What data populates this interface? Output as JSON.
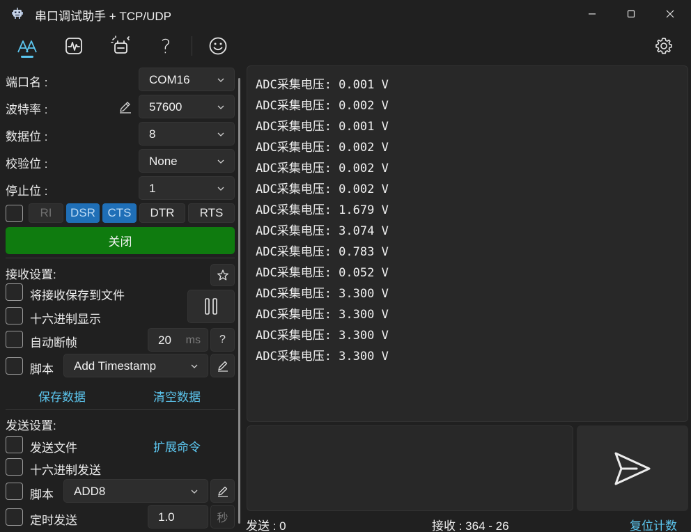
{
  "window": {
    "title": "串口调试助手 + TCP/UDP",
    "icons": [
      "app-robot-icon",
      "minimize-icon",
      "maximize-icon",
      "close-icon"
    ]
  },
  "toolbar": {
    "icons": [
      "font-tool-icon",
      "waveform-icon",
      "magic-icon",
      "help-icon",
      "smiley-icon",
      "gear-icon"
    ],
    "help_glyph": "?"
  },
  "serial": {
    "port_label": "端口名 :",
    "port_value": "COM16",
    "baud_label": "波特率 :",
    "baud_value": "57600",
    "databits_label": "数据位 :",
    "databits_value": "8",
    "parity_label": "校验位 :",
    "parity_value": "None",
    "stopbits_label": "停止位 :",
    "stopbits_value": "1",
    "signals": {
      "ri": "RI",
      "dsr": "DSR",
      "cts": "CTS",
      "dtr": "DTR",
      "rts": "RTS"
    },
    "open_close_label": "关闭"
  },
  "receive": {
    "title": "接收设置:",
    "save_to_file": "将接收保存到文件",
    "hex_display": "十六进制显示",
    "auto_frame": "自动断帧",
    "frame_ms": "20",
    "frame_unit": "ms",
    "frame_help": "?",
    "script": "脚本",
    "script_value": "Add Timestamp",
    "save_data": "保存数据",
    "clear_data": "清空数据",
    "lines": [
      "ADC采集电压: 0.001 V",
      "ADC采集电压: 0.002 V",
      "ADC采集电压: 0.001 V",
      "ADC采集电压: 0.002 V",
      "ADC采集电压: 0.002 V",
      "ADC采集电压: 0.002 V",
      "ADC采集电压: 1.679 V",
      "ADC采集电压: 3.074 V",
      "ADC采集电压: 0.783 V",
      "ADC采集电压: 0.052 V",
      "ADC采集电压: 3.300 V",
      "ADC采集电压: 3.300 V",
      "ADC采集电压: 3.300 V",
      "ADC采集电压: 3.300 V"
    ]
  },
  "send": {
    "title": "发送设置:",
    "send_file": "发送文件",
    "ext_commands": "扩展命令",
    "hex_send": "十六进制发送",
    "script": "脚本",
    "script_value": "ADD8",
    "timed_send": "定时发送",
    "timed_value": "1.0",
    "timed_unit": "秒"
  },
  "status": {
    "sent": "发送 : 0",
    "received": "接收 : 364  -  26",
    "reset": "复位计数"
  },
  "colors": {
    "accent": "#5cc6ef",
    "open_button": "#0f7b0f",
    "signal_on": "#1f6fb7"
  }
}
